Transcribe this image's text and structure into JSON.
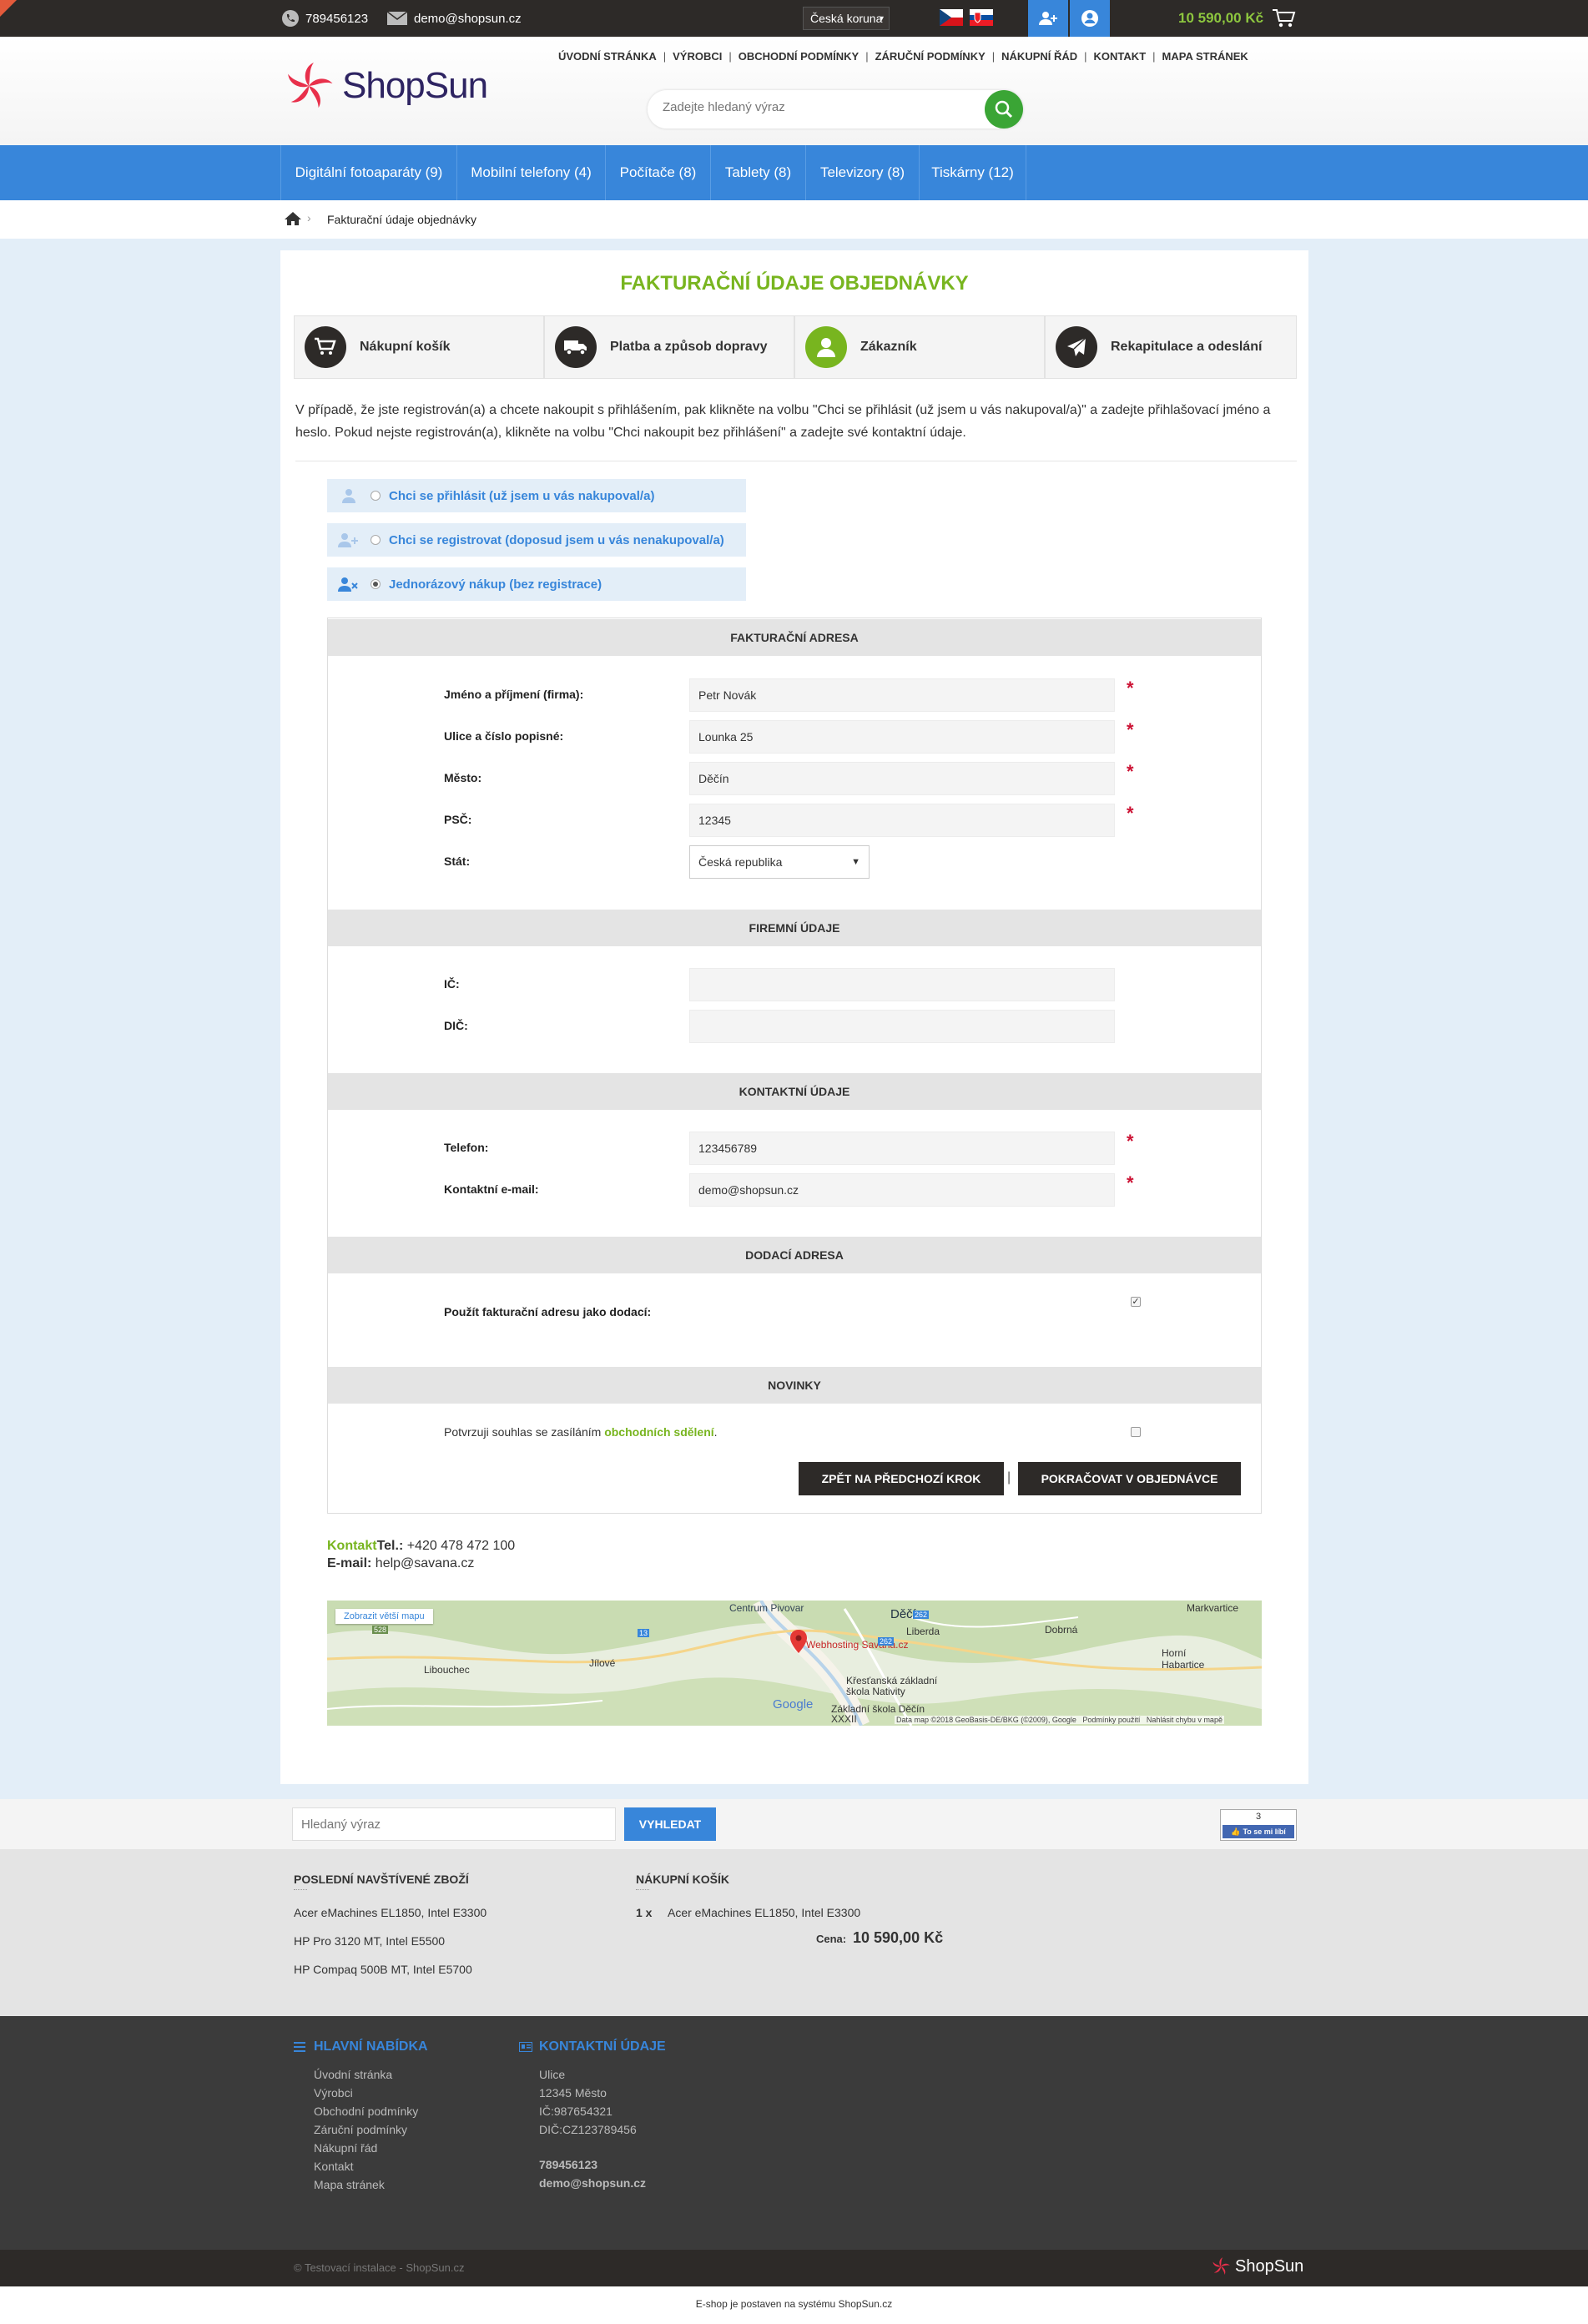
{
  "topbar": {
    "phone": "789456123",
    "email": "demo@shopsun.cz",
    "currency": "Česká koruna",
    "cart_total": "10 590,00 Kč",
    "accent": "#8dc63f"
  },
  "header": {
    "logo_text": "ShopSun",
    "search_placeholder": "Zadejte hledaný výraz",
    "top_menu": [
      "ÚVODNÍ STRÁNKA",
      "VÝROBCI",
      "OBCHODNÍ PODMÍNKY",
      "ZÁRUČNÍ PODMÍNKY",
      "NÁKUPNÍ ŘÁD",
      "KONTAKT",
      "MAPA STRÁNEK"
    ]
  },
  "nav": {
    "items": [
      "Digitální fotoaparáty (9)",
      "Mobilní telefony (4)",
      "Počítače (8)",
      "Tablety (8)",
      "Televizory (8)",
      "Tiskárny (12)"
    ],
    "color": "#3886da"
  },
  "breadcrumb": {
    "current": "Fakturační údaje objednávky"
  },
  "page": {
    "title": "FAKTURAČNÍ ÚDAJE OBJEDNÁVKY",
    "steps": [
      "Nákupní košík",
      "Platba a způsob dopravy",
      "Zákazník",
      "Rekapitulace a odeslání"
    ],
    "intro": "V případě, že jste registrován(a) a chcete nakoupit s přihlášením, pak klikněte na volbu \"Chci se přihlásit (už jsem u vás nakupoval/a)\" a zadejte přihlašovací jméno a heslo. Pokud nejste registrován(a), klikněte na volbu \"Chci nakoupit bez přihlášení\" a zadejte své kontaktní údaje.",
    "options": [
      "Chci se přihlásit (už jsem u vás nakupoval/a)",
      "Chci se registrovat (doposud jsem u vás nenakupoval/a)",
      "Jednorázový nákup (bez registrace)"
    ]
  },
  "form": {
    "billing_head": "FAKTURAČNÍ ADRESA",
    "name_label": "Jméno a příjmení (firma):",
    "name_value": "Petr Novák",
    "street_label": "Ulice a číslo popisné:",
    "street_value": "Lounka 25",
    "city_label": "Město:",
    "city_value": "Děčín",
    "zip_label": "PSČ:",
    "zip_value": "12345",
    "country_label": "Stát:",
    "country_value": "Česká republika",
    "company_head": "FIREMNÍ ÚDAJE",
    "ic_label": "IČ:",
    "dic_label": "DIČ:",
    "contact_head": "KONTAKTNÍ ÚDAJE",
    "phone_label": "Telefon:",
    "phone_value": "123456789",
    "email_label": "Kontaktní e-mail:",
    "email_value": "demo@shopsun.cz",
    "delivery_head": "DODACÍ ADRESA",
    "delivery_label": "Použít fakturační adresu jako dodací:",
    "news_head": "NOVINKY",
    "news_text": "Potvrzuji souhlas se zasíláním",
    "news_link": "obchodních sdělení",
    "news_dot": ".",
    "back_button": "ZPĚT NA PŘEDCHOZÍ KROK",
    "continue_button": "POKRAČOVAT V OBJEDNÁVCE",
    "required_mark": "*"
  },
  "contact": {
    "kontakt": "Kontakt",
    "tel_label": "Tel.:",
    "tel": " +420 478 472 100",
    "email_label": "E-mail:",
    "email": " help@savana.cz"
  },
  "map": {
    "bigger_map": "Zobrazit větší mapu",
    "labels": [
      "Centrum Pivovar",
      "Děčín",
      "Markvartice",
      "Dobrná",
      "Liberda",
      "Webhosting Savana.cz",
      "Libouchec",
      "Jílové",
      "Horní Habartice",
      "Křesťanská základní škola Nativity",
      "Základní škola Děčín XXXII"
    ],
    "road_labels": [
      "528",
      "13",
      "262",
      "262"
    ],
    "google": "Google",
    "attribution": "Data map ©2018 GeoBasis-DE/BKG (©2009), Google   Podmínky použití   Nahlásit chybu v mapě"
  },
  "bottom_search": {
    "placeholder": "Hledaný výraz",
    "button": "VYHLEDAT",
    "fb_count": "3",
    "fb_like": "To se mi líbí"
  },
  "recent": {
    "head": "POSLEDNÍ NAVŠTÍVENÉ ZBOŽÍ",
    "items": [
      "Acer eMachines EL1850, Intel E3300",
      "HP Pro 3120 MT, Intel E5500",
      "HP Compaq 500B MT, Intel E5700"
    ],
    "cart_head": "NÁKUPNÍ KOŠÍK",
    "cart_qty": "1 x",
    "cart_item": "Acer eMachines EL1850, Intel E3300",
    "price_label": "Cena:",
    "price": "10 590,00 Kč"
  },
  "footer": {
    "menu_head": "HLAVNÍ NABÍDKA",
    "menu": [
      "Úvodní stránka",
      "Výrobci",
      "Obchodní podmínky",
      "Záruční podmínky",
      "Nákupní řád",
      "Kontakt",
      "Mapa stránek"
    ],
    "contact_head": "KONTAKTNÍ ÚDAJE",
    "contact": [
      "Ulice",
      "12345 Město",
      "IČ:987654321",
      "DIČ:CZ123789456"
    ],
    "phone": "789456123",
    "email": "demo@shopsun.cz",
    "copyright": "© Testovací instalace - ShopSun.cz",
    "logo": "ShopSun",
    "powered": "E-shop je postaven na systému ShopSun.cz"
  }
}
